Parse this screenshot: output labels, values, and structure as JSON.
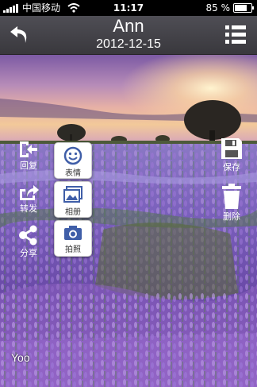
{
  "status_bar": {
    "carrier": "中国移动",
    "time": "11:17",
    "battery": "85 %",
    "battery_level": 0.85
  },
  "header": {
    "title": "Ann",
    "date": "2012-12-15"
  },
  "left_actions": [
    {
      "label": "回复",
      "icon": "reply-icon"
    },
    {
      "label": "转发",
      "icon": "forward-icon"
    },
    {
      "label": "分享",
      "icon": "share-icon"
    }
  ],
  "tiles": [
    {
      "label": "表情",
      "icon": "smiley-icon"
    },
    {
      "label": "相册",
      "icon": "album-icon"
    },
    {
      "label": "拍照",
      "icon": "camera-icon"
    }
  ],
  "right_actions": [
    {
      "label": "保存",
      "icon": "save-icon"
    },
    {
      "label": "删除",
      "icon": "trash-icon"
    }
  ],
  "caption": "Yoo"
}
